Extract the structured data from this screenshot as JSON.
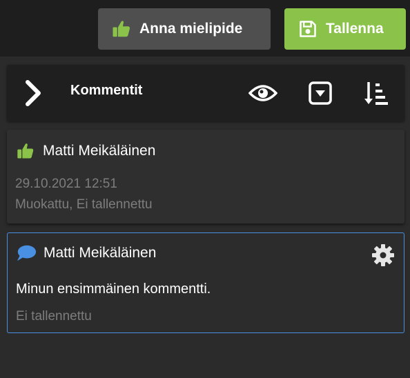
{
  "toolbar": {
    "feedback_label": "Anna mielipide",
    "save_label": "Tallenna"
  },
  "comments_panel": {
    "title": "Kommentit"
  },
  "comments": [
    {
      "type": "feedback",
      "author": "Matti Meikäläinen",
      "date": "29.10.2021 12:51",
      "status": "Muokattu, Ei tallennettu"
    },
    {
      "type": "comment",
      "author": "Matti Meikäläinen",
      "text": "Minun ensimmäinen kommentti.",
      "status": "Ei tallennettu"
    }
  ],
  "colors": {
    "accent_green": "#8bc34a",
    "accent_blue": "#4a90e2",
    "topbar_bg": "#1e1e1e",
    "panel_bg": "#2b2b2b"
  },
  "icons": {
    "feedback": "thumbs-up-icon",
    "save": "floppy-disk-icon",
    "toggle": "chevron-right-icon",
    "visibility": "eye-icon",
    "filter": "dropdown-square-icon",
    "sort": "sort-amount-down-icon",
    "comment": "speech-bubble-icon",
    "settings": "gear-icon"
  }
}
